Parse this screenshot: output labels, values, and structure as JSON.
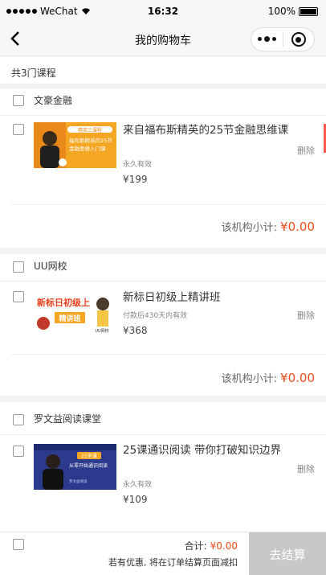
{
  "status_bar": {
    "carrier": "WeChat",
    "time": "16:32",
    "battery": "100%"
  },
  "nav": {
    "title": "我的购物车"
  },
  "cart": {
    "count_text": "共3门课程"
  },
  "orgs": [
    {
      "name": "文豪金融",
      "item": {
        "title": "来自福布斯精英的25节金融思维课",
        "validity": "永久有效",
        "price": "¥199",
        "delete": "删除",
        "thumb": {
          "line1": "福布斯精英的25节",
          "line2": "金融思维入门课",
          "tag": "精英三课程"
        }
      },
      "subtotal_label": "该机构小计:",
      "subtotal_amount": "¥0.00"
    },
    {
      "name": "UU网校",
      "item": {
        "title": "新标日初级上精讲班",
        "validity": "付款后430天内有效",
        "price": "¥368",
        "delete": "删除",
        "thumb": {
          "line1": "新标日初级上",
          "line2": "精讲班",
          "tag": "UU网校"
        }
      },
      "subtotal_label": "该机构小计:",
      "subtotal_amount": "¥0.00"
    },
    {
      "name": "罗文益阅读课堂",
      "item": {
        "title": "25课通识阅读 带你打破知识边界",
        "validity": "永久有效",
        "price": "¥109",
        "delete": "删除",
        "thumb": {
          "line1": "25堂课",
          "line2": "从零开始通识阅读",
          "tag": "罗文益阅读"
        }
      }
    }
  ],
  "footer": {
    "total_label": "合计:",
    "total_amount": "¥0.00",
    "note": "若有优惠, 将在订单结算页面减扣",
    "checkout": "去结算"
  }
}
